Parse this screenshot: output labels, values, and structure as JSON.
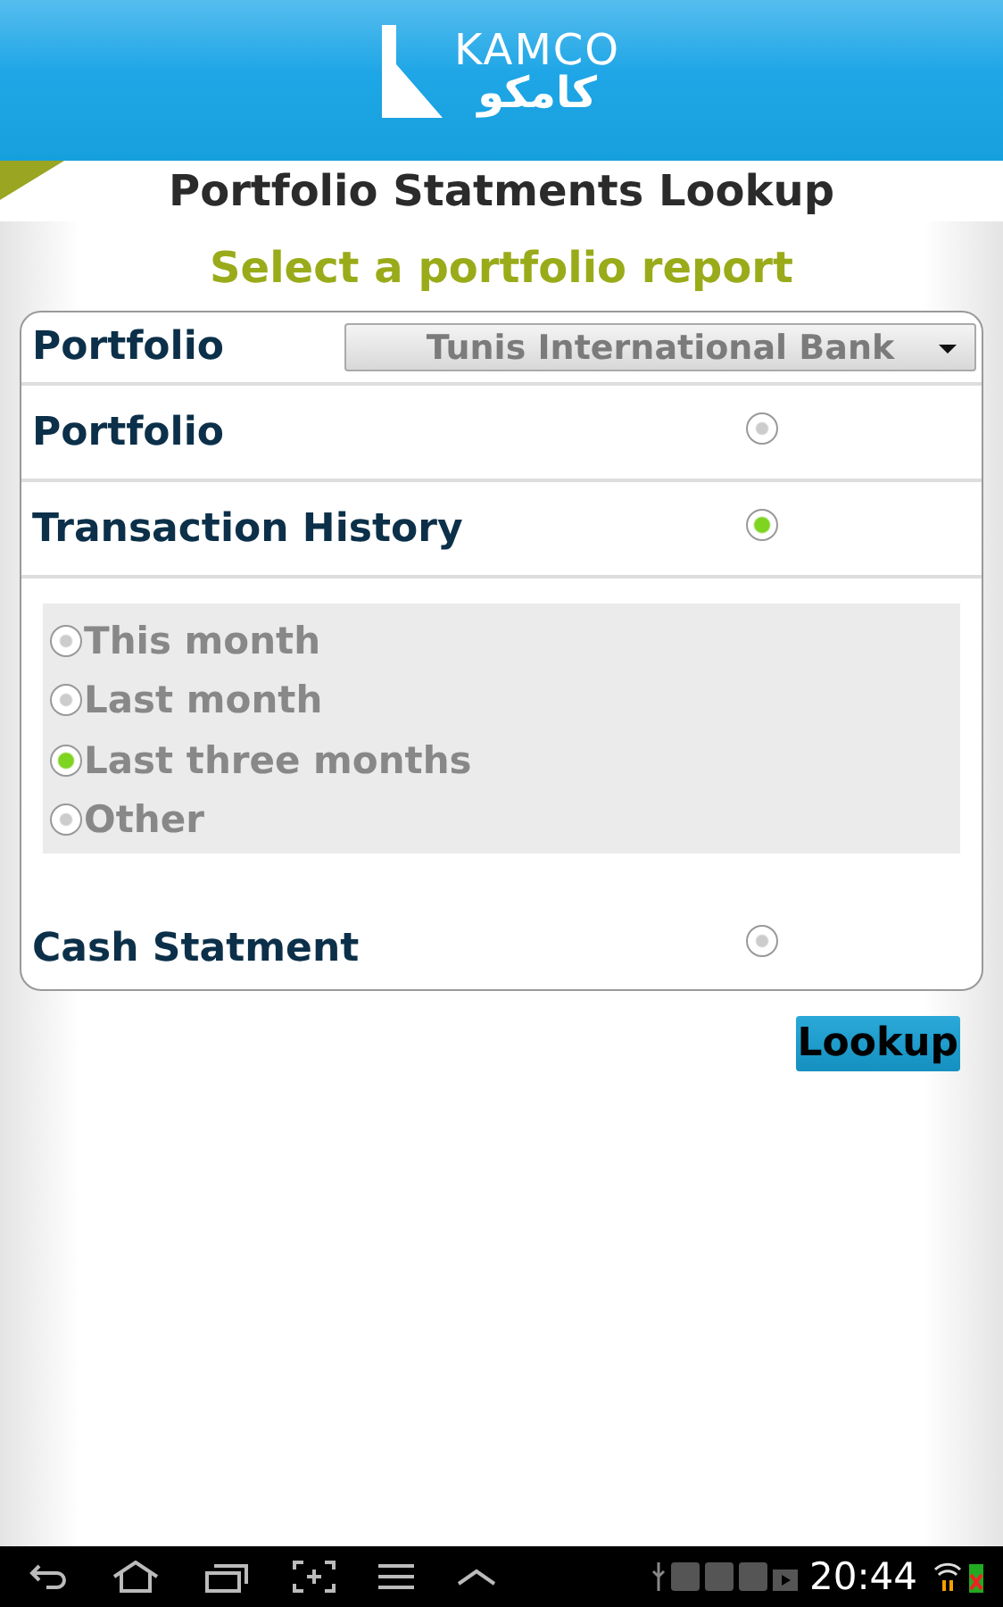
{
  "logo": {
    "latin": "KAMCO",
    "arabic": "كامكو"
  },
  "title": "Portfolio Statments Lookup",
  "subtitle": "Select a portfolio report",
  "portfolio_select": {
    "label": "Portfolio",
    "value": "Tunis International Bank"
  },
  "reports": [
    {
      "label": "Portfolio",
      "selected": false
    },
    {
      "label": "Transaction History",
      "selected": true,
      "options": [
        {
          "label": "This month",
          "selected": false
        },
        {
          "label": "Last month",
          "selected": false
        },
        {
          "label": "Last three months",
          "selected": true
        },
        {
          "label": "Other",
          "selected": false
        }
      ]
    },
    {
      "label": "Cash Statment",
      "selected": false
    }
  ],
  "lookup_button": "Lookup",
  "status_bar": {
    "time": "20:44"
  }
}
